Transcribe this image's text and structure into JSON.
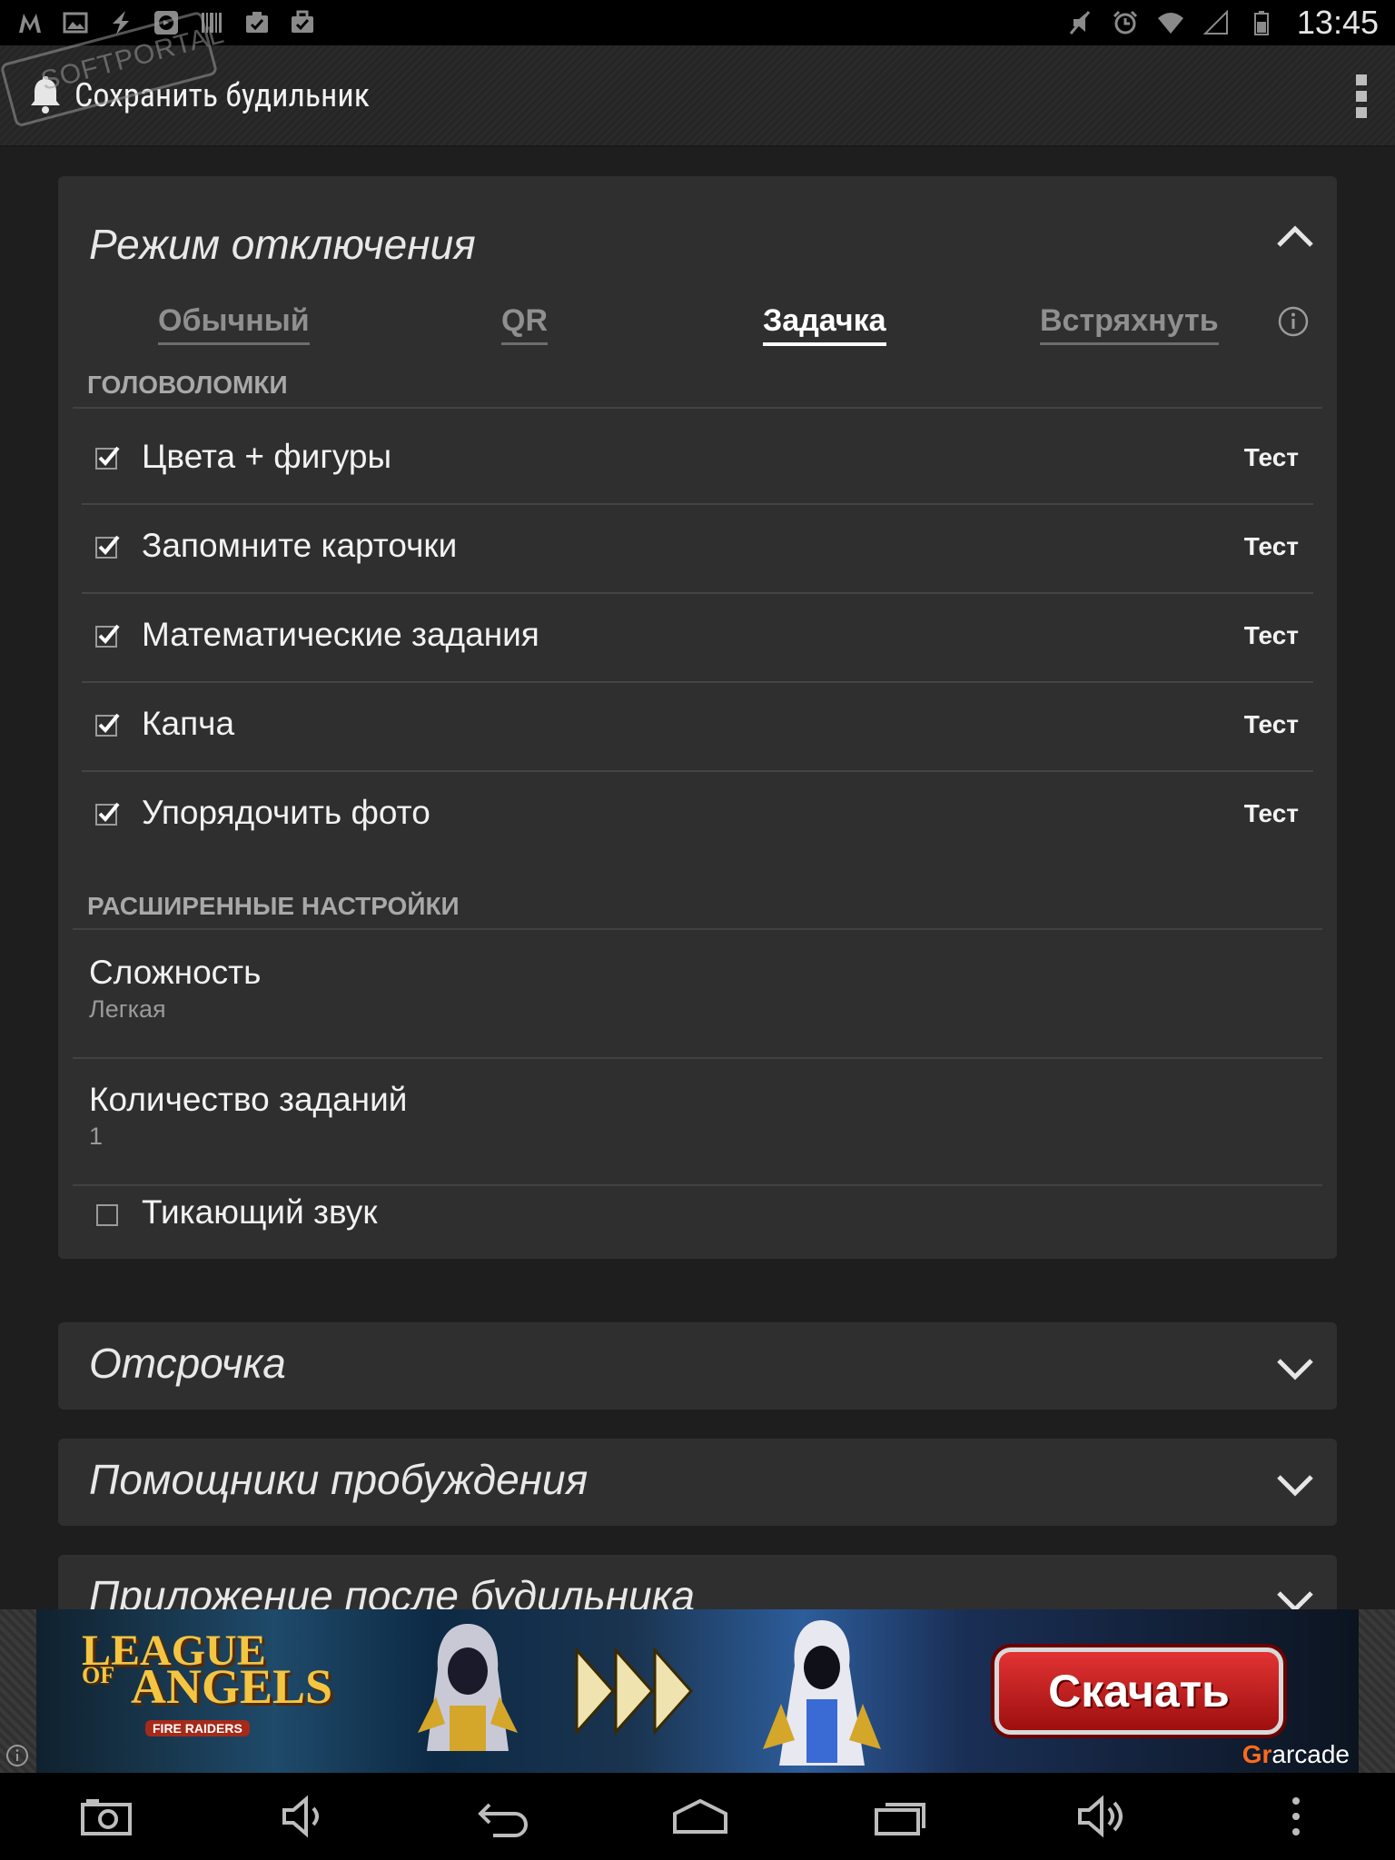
{
  "status_bar": {
    "time": "13:45",
    "left_icons": [
      "m-icon",
      "image-icon",
      "bolt-icon",
      "app-icon",
      "barcode-icon",
      "clipboard-check-icon",
      "briefcase-check-icon"
    ],
    "right_icons": [
      "mute-icon",
      "alarm-icon",
      "wifi-icon",
      "signal-icon",
      "battery-icon"
    ]
  },
  "watermark": {
    "text": "SOFTPORTAL"
  },
  "action_bar": {
    "title": "Сохранить будильник"
  },
  "dismiss_card": {
    "title": "Режим отключения",
    "tabs": [
      {
        "label": "Обычный",
        "active": false
      },
      {
        "label": "QR",
        "active": false
      },
      {
        "label": "Задачка",
        "active": true
      },
      {
        "label": "Встряхнуть",
        "active": false
      }
    ],
    "puzzles_header": "ГОЛОВОЛОМКИ",
    "puzzles": [
      {
        "label": "Цвета + фигуры",
        "checked": true,
        "test": "Тест"
      },
      {
        "label": "Запомните карточки",
        "checked": true,
        "test": "Тест"
      },
      {
        "label": "Математические задания",
        "checked": true,
        "test": "Тест"
      },
      {
        "label": "Капча",
        "checked": true,
        "test": "Тест"
      },
      {
        "label": "Упорядочить фото",
        "checked": true,
        "test": "Тест"
      }
    ],
    "advanced_header": "РАСШИРЕННЫЕ НАСТРОЙКИ",
    "difficulty": {
      "title": "Сложность",
      "value": "Легкая"
    },
    "task_count": {
      "title": "Количество заданий",
      "value": "1"
    },
    "ticking": {
      "label": "Тикающий звук",
      "checked": false
    }
  },
  "collapsed_cards": [
    {
      "title": "Отсрочка"
    },
    {
      "title": "Помощники пробуждения"
    },
    {
      "title": "Приложение после будильника"
    }
  ],
  "ad": {
    "logo_line1": "LEAGUE",
    "logo_of": "OF",
    "logo_line2": "ANGELS",
    "logo_sub": "FIRE RAIDERS",
    "button": "Скачать",
    "brand_mark": "Gr",
    "brand": "arcade"
  },
  "colors": {
    "background": "#1e1e1e",
    "card": "#2f2f2f",
    "accent": "#ffffff",
    "muted": "#8f8f8f"
  }
}
